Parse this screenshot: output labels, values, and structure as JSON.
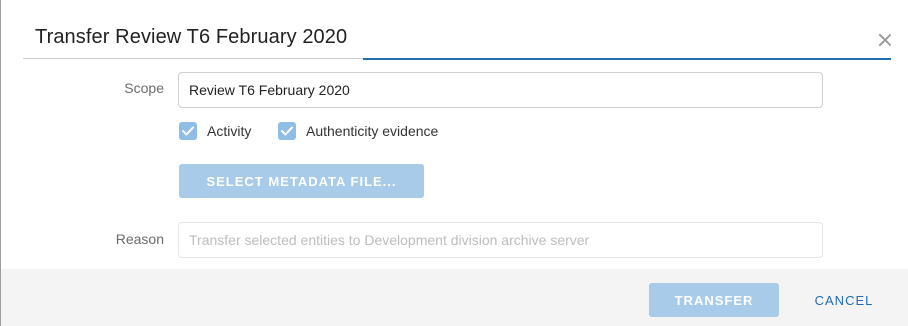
{
  "dialog": {
    "title": "Transfer Review T6 February 2020",
    "close_icon": "close-icon"
  },
  "form": {
    "scope_label": "Scope",
    "scope_value": "Review T6 February 2020",
    "checkboxes": [
      {
        "label": "Activity",
        "checked": true
      },
      {
        "label": "Authenticity evidence",
        "checked": true
      }
    ],
    "select_metadata_label": "SELECT METADATA FILE...",
    "reason_label": "Reason",
    "reason_placeholder": "Transfer selected entities to Development division archive server",
    "reason_value": ""
  },
  "footer": {
    "transfer_label": "TRANSFER",
    "cancel_label": "CANCEL"
  },
  "colors": {
    "accent": "#1f6db3",
    "button_disabled": "#a7cbe9",
    "checkbox": "#8ebde6"
  }
}
